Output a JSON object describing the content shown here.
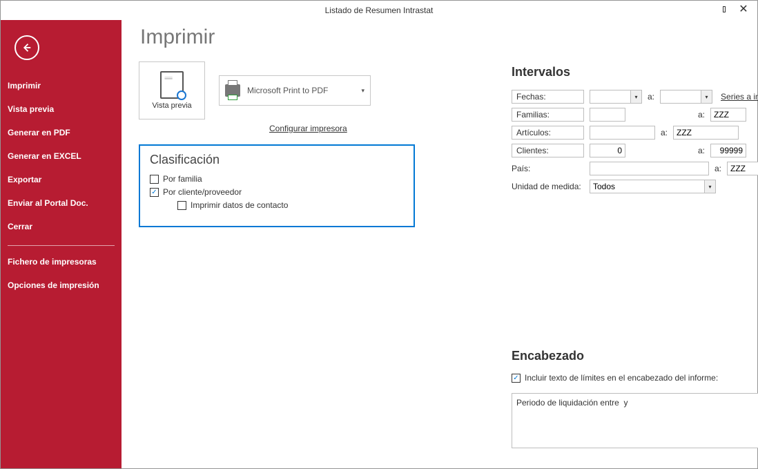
{
  "window": {
    "title": "Listado de Resumen Intrastat"
  },
  "sidebar": {
    "items": [
      {
        "label": "Imprimir"
      },
      {
        "label": "Vista previa"
      },
      {
        "label": "Generar en PDF"
      },
      {
        "label": "Generar en EXCEL"
      },
      {
        "label": "Exportar"
      },
      {
        "label": "Enviar al Portal Doc."
      },
      {
        "label": "Cerrar"
      }
    ],
    "items2": [
      {
        "label": "Fichero de impresoras"
      },
      {
        "label": "Opciones de impresión"
      }
    ]
  },
  "page": {
    "title": "Imprimir",
    "preview_label": "Vista previa",
    "printer_name": "Microsoft Print to PDF",
    "configure_link": "Configurar impresora"
  },
  "classification": {
    "title": "Clasificación",
    "by_family": "Por familia",
    "by_client": "Por cliente/proveedor",
    "print_contact": "Imprimir datos de contacto"
  },
  "intervals": {
    "title": "Intervalos",
    "to_label": "a:",
    "series_link": "Series a imprimir:",
    "rows": {
      "dates": {
        "label": "Fechas:",
        "from": "",
        "to": ""
      },
      "families": {
        "label": "Familias:",
        "from": "",
        "to": "ZZZ"
      },
      "articles": {
        "label": "Artículos:",
        "from": "",
        "to": "ZZZ"
      },
      "clients": {
        "label": "Clientes:",
        "from": "0",
        "to": "99999"
      },
      "country": {
        "label": "País:",
        "from": "",
        "to": "ZZZ"
      },
      "unit": {
        "label": "Unidad de medida:",
        "value": "Todos"
      }
    }
  },
  "header": {
    "title": "Encabezado",
    "include_label": "Incluir texto de límites en el encabezado del informe:",
    "text": "Periodo de liquidación entre  y"
  }
}
